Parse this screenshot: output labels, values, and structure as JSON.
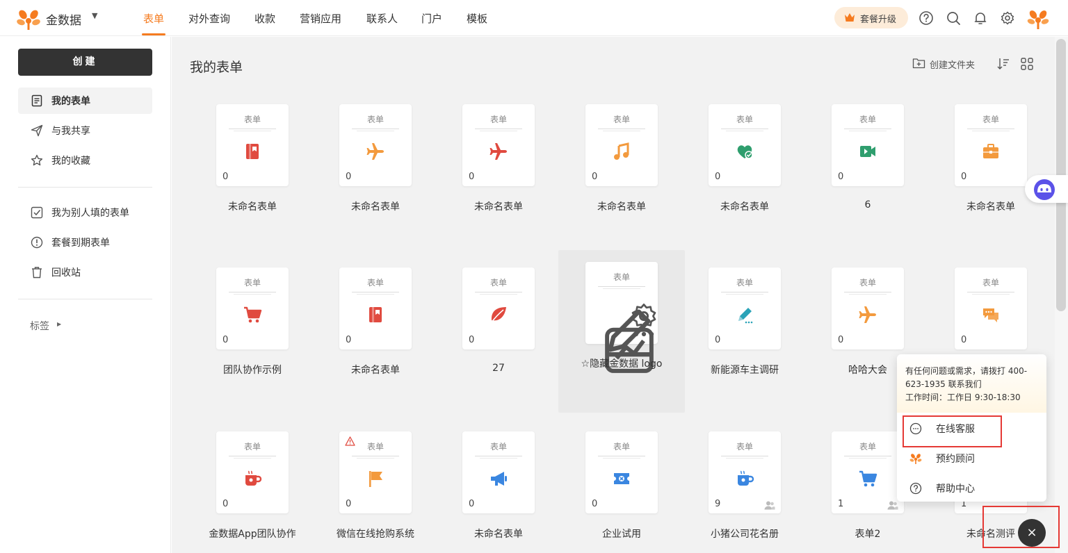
{
  "header": {
    "brand": "金数据",
    "nav": [
      "表单",
      "对外查询",
      "收款",
      "营销应用",
      "联系人",
      "门户",
      "模板"
    ],
    "active_nav": "表单",
    "upgrade_label": "套餐升级",
    "accent_color": "#f57b1f"
  },
  "sidebar": {
    "create_label": "创建",
    "items": [
      {
        "label": "我的表单",
        "icon": "document-icon"
      },
      {
        "label": "与我共享",
        "icon": "send-icon"
      },
      {
        "label": "我的收藏",
        "icon": "star-icon"
      },
      {
        "label": "我为别人填的表单",
        "icon": "checkbox-icon"
      },
      {
        "label": "套餐到期表单",
        "icon": "alert-circle-icon"
      },
      {
        "label": "回收站",
        "icon": "trash-icon"
      }
    ],
    "tags_label": "标签"
  },
  "main": {
    "title": "我的表单",
    "create_folder_label": "创建文件夹",
    "card_type_label": "表单",
    "forms": [
      {
        "title": "未命名表单",
        "count": "0",
        "icon": "book-icon",
        "color": "#e04a3f"
      },
      {
        "title": "未命名表单",
        "count": "0",
        "icon": "plane-icon",
        "color": "#f39a3d"
      },
      {
        "title": "未命名表单",
        "count": "0",
        "icon": "plane-icon",
        "color": "#e04a3f"
      },
      {
        "title": "未命名表单",
        "count": "0",
        "icon": "music-icon",
        "color": "#f39a3d"
      },
      {
        "title": "未命名表单",
        "count": "0",
        "icon": "heart-icon",
        "color": "#2f9e6e"
      },
      {
        "title": "6",
        "count": "0",
        "icon": "video-icon",
        "color": "#2f9e6e"
      },
      {
        "title": "未命名表单",
        "count": "0",
        "icon": "briefcase-icon",
        "color": "#f39a3d"
      },
      {
        "title": "团队协作示例",
        "count": "0",
        "icon": "cart-icon",
        "color": "#e04a3f"
      },
      {
        "title": "未命名表单",
        "count": "0",
        "icon": "book-icon",
        "color": "#e04a3f"
      },
      {
        "title": "27",
        "count": "0",
        "icon": "leaf-icon",
        "color": "#e04a3f"
      },
      {
        "title": "☆隐藏金数据 logo",
        "count": "",
        "icon": "hover-actions",
        "color": "#666666"
      },
      {
        "title": "新能源车主调研",
        "count": "0",
        "icon": "pencil-icon",
        "color": "#2aa3b8"
      },
      {
        "title": "哈哈大会",
        "count": "0",
        "icon": "plane-icon",
        "color": "#f39a3d"
      },
      {
        "title": "",
        "count": "0",
        "icon": "chat-icon",
        "color": "#f39a3d"
      },
      {
        "title": "金数据App团队协作",
        "count": "0",
        "icon": "cup-icon",
        "color": "#e04a3f"
      },
      {
        "title": "微信在线抢购系统",
        "count": "0",
        "icon": "flag-icon",
        "color": "#f39a3d",
        "warning": true
      },
      {
        "title": "未命名表单",
        "count": "0",
        "icon": "megaphone-icon",
        "color": "#3a86e0"
      },
      {
        "title": "企业试用",
        "count": "0",
        "icon": "ticket-icon",
        "color": "#3a86e0"
      },
      {
        "title": "小猪公司花名册",
        "count": "9",
        "icon": "cup-icon",
        "color": "#3a86e0",
        "shared": true
      },
      {
        "title": "表单2",
        "count": "1",
        "icon": "cart-icon",
        "color": "#3a86e0",
        "shared": true
      },
      {
        "title": "未命名测评",
        "count": "1",
        "icon": "none",
        "color": "#3a86e0"
      }
    ]
  },
  "help": {
    "notice": "有任何问题或需求，请拨打 400-623-1935 联系我们",
    "hours": "工作时间：工作日 9:30-18:30",
    "items": [
      "在线客服",
      "预约顾问",
      "帮助中心"
    ]
  },
  "close_label": "×"
}
